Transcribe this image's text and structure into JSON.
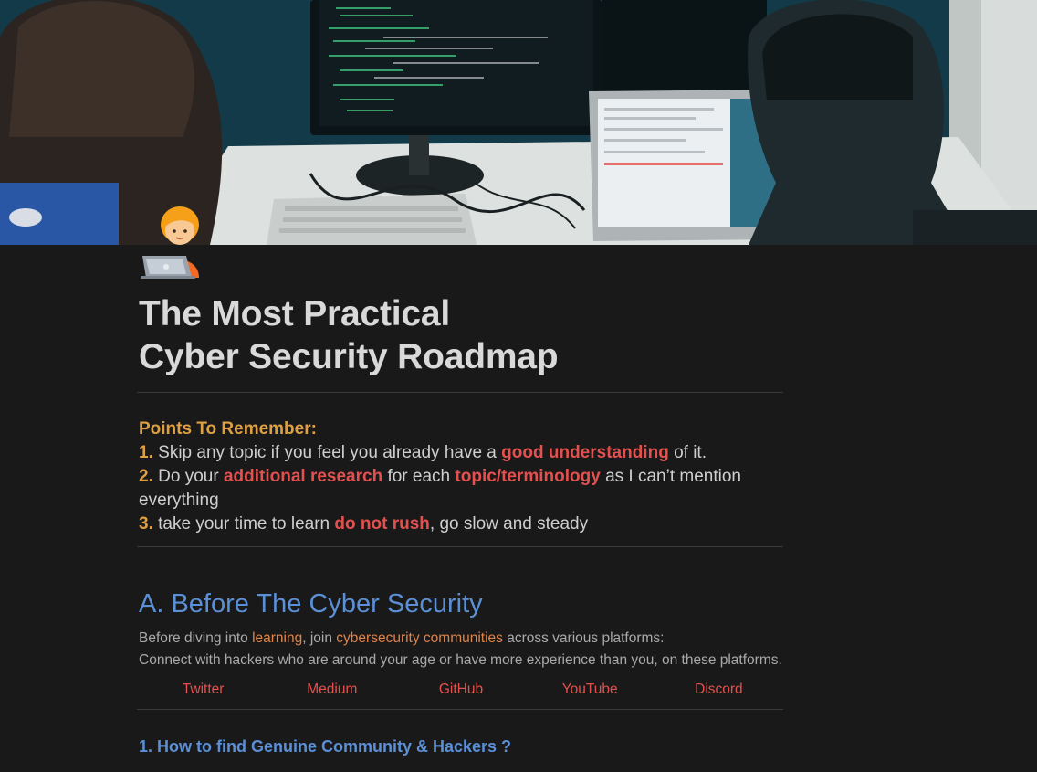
{
  "page": {
    "title_line1": "The Most Practical",
    "title_line2": "Cyber Security Roadmap",
    "icon": "technologist-emoji"
  },
  "cover": {
    "icon": "cover-photo"
  },
  "points": {
    "heading": "Points To Remember:",
    "items": [
      {
        "num": "1.",
        "t1": "Skip any topic if you feel you already have a ",
        "h1": "good understanding",
        "t2": " of it."
      },
      {
        "num": "2.",
        "t1": "Do your ",
        "h1": "additional research",
        "t2": " for each ",
        "h2": "topic/terminology",
        "t3": " as I can’t mention everything"
      },
      {
        "num": "3.",
        "t1": "take your time to learn ",
        "h1": "do not rush",
        "t2": ", go slow and steady"
      }
    ]
  },
  "sectionA": {
    "title": "A. Before The Cyber Security",
    "p1_a": "Before diving into ",
    "p1_link1": "learning",
    "p1_b": ", join ",
    "p1_link2": "cybersecurity communities",
    "p1_c": " across various platforms:",
    "p2": "Connect with hackers who are around your age or have more experience than you, on these platforms.",
    "platforms": [
      "Twitter",
      "Medium",
      "GitHub",
      "YouTube",
      "Discord"
    ],
    "sub1": "1. How to find Genuine Community & Hackers ?"
  },
  "colors": {
    "background": "#191919",
    "heading_orange": "#dfa044",
    "highlight_red": "#e2514f",
    "link_orange": "#df8449",
    "section_blue": "#5b8fd6"
  }
}
